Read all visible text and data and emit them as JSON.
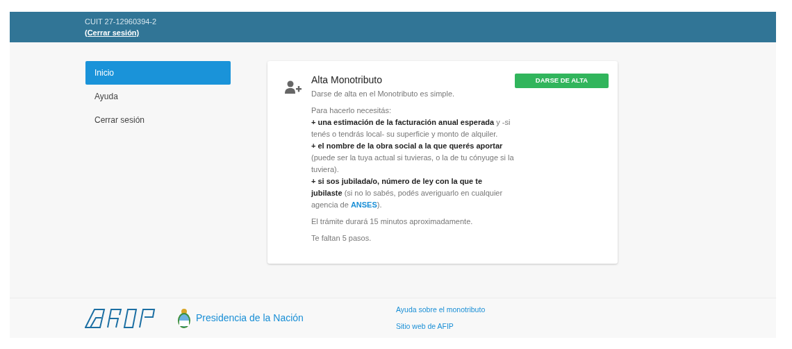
{
  "header": {
    "cuit": "CUIT 27-12960394-2",
    "logout_link": "(Cerrar sesión)"
  },
  "sidebar": {
    "items": [
      {
        "label": "Inicio",
        "selected": true
      },
      {
        "label": "Ayuda",
        "selected": false
      },
      {
        "label": "Cerrar sesión",
        "selected": false
      }
    ]
  },
  "card": {
    "title": "Alta Monotributo",
    "subtitle": "Darse de alta en el Monotributo es simple.",
    "button": "DARSE DE ALTA",
    "requirements_intro": "Para hacerlo necesitás:",
    "requirements": [
      {
        "text": "**+ una estimación de la facturación anual esperada** y -si tenés o tendrás local- su superficie y monto de alquiler."
      },
      {
        "text": "**+ el nombre de la obra social a la que querés aportar** (puede ser la tuya actual si tuvieras, o la de tu cónyuge si la tuviera)."
      },
      {
        "text": "**+ si sos jubilada/o, número de ley con la que te jubilaste** (si no lo sabés, podés averiguarlo en cualquier agencia de",
        "link": "ANSES",
        "after": ")."
      }
    ],
    "duration": "El trámite durará 15 minutos aproximadamente.",
    "steps": "Te faltan 5 pasos."
  },
  "footer": {
    "presidency": "Presidencia de la Nación",
    "links": [
      "Ayuda sobre el monotributo",
      "Sitio web de AFIP"
    ]
  }
}
